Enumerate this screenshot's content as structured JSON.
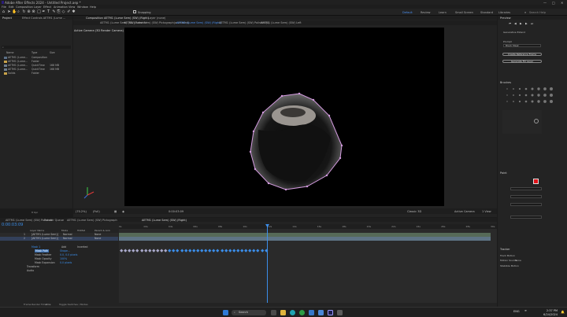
{
  "window": {
    "title": "Adobe After Effects 2024 - Untitled Project.aep *"
  },
  "menu": [
    "File",
    "Edit",
    "Composition",
    "Layer",
    "Effect",
    "Animation",
    "View",
    "Window",
    "Help"
  ],
  "toolbar": {
    "snapping_label": "Snapping",
    "default_label": "Default"
  },
  "workspaces": {
    "items": [
      "Default",
      "Review",
      "Learn",
      "Small Screen",
      "Standard",
      "Libraries"
    ],
    "active": "Default",
    "search_placeholder": "Search Help"
  },
  "project_panel": {
    "tab": "Project",
    "effect_tab": "Effect Controls AETM1 (Lume ...",
    "columns": {
      "name": "Name",
      "type": "Type",
      "size": "Size"
    },
    "items": [
      {
        "name": "AETM1 (Lume...",
        "type": "Composition",
        "size": ""
      },
      {
        "name": "AETM1 (Lume...",
        "type": "Folder",
        "size": ""
      },
      {
        "name": "AETM1 (Lume...",
        "type": "QuickTime",
        "size": "168 MB"
      },
      {
        "name": "AETM1 (Lume...",
        "type": "QuickTime",
        "size": "168 MB"
      },
      {
        "name": "Solids",
        "type": "Folder",
        "size": ""
      }
    ],
    "bpc": "8 bpc"
  },
  "composition_panel": {
    "tab_label": "Composition AETM1 (Lume Sem) (SW) (Right)",
    "layer_tab": "Layer (none)",
    "view_tabs": [
      "AETM1 (Lume Sem) (SW) Polished",
      "AETM1 (Lume Sem) (SW) Pictograph(animated)",
      "AETM1 (Lume Sem) (SW) (Right)",
      "AETM1 (Lume Sem) (SW) Polished(1)",
      "AETM1 (Lume Sem) (SW) Left"
    ],
    "camera_label": "Active Camera (3D Render Camera)",
    "zoom": "(70.2%)",
    "resolution": "(Full)",
    "timecode": "0:00:03:09",
    "renderer_label": "Classic 3D",
    "view_label": "Active Camera",
    "views_label": "1 View"
  },
  "right_panel": {
    "tabs": [
      "Info",
      "Audio",
      "Properties",
      "Libraries"
    ],
    "preview_title": "Preview",
    "generative_title": "Generative Extend",
    "prompt_label": "Prompt",
    "prompt_value": "Black Mask",
    "btn_1": "Create Reference Frame",
    "btn_2": "Generate Fill Layer",
    "brushes_title": "Brushes",
    "paint_title": "Paint",
    "tracker_title": "Tracker",
    "track_motion": "Track Motion",
    "stabilize": "Stabilize Motion",
    "motion_source": "Motion Source",
    "motion_source_value": "None"
  },
  "timeline_panel": {
    "tabs": [
      "AETM1 (Lume Sem) (SW) Polished",
      "Render Queue",
      "AETM1 (Lume Sem) (SW) Pictograph",
      "AETM1 (Lume Sem) (SW) (Right)"
    ],
    "timecode": "0:00:03:09",
    "columns": {
      "layer_name": "Layer Name",
      "mode": "Mode",
      "trkmat": "TrkMat",
      "parent": "Parent & Link"
    },
    "layers": [
      {
        "index": "1",
        "name": "[AETM1 (Lume Sem)]",
        "mode": "Normal",
        "parent": "None"
      },
      {
        "index": "2",
        "name": "[AETM1 (Lume Sem)]",
        "mode": "Normal",
        "parent": "None"
      }
    ],
    "masks": [
      {
        "name": "Mask 1",
        "mode": "Add",
        "value": "Inverted"
      },
      {
        "name": "Mask Path",
        "value": "Shape..."
      },
      {
        "name": "Mask Feather",
        "value": "0.0, 0.0 pixels"
      },
      {
        "name": "Mask Opacity",
        "value": "100%"
      },
      {
        "name": "Mask Expansion",
        "value": "0.0 pixels"
      }
    ],
    "transform_label": "Transform",
    "audio_label": "Audio",
    "frame_render": "Frame Render Time",
    "frame_render_value": "0ms",
    "toggle_label": "Toggle Switches / Modes",
    "ruler_ticks": [
      "0s",
      "02s",
      "04s",
      "06s",
      "08s",
      "10s",
      "12s",
      "14s",
      "16s",
      "18s",
      "20s",
      "22s",
      "24s",
      "26s",
      "28s",
      "30s"
    ]
  },
  "taskbar": {
    "search_placeholder": "Search",
    "time": "2:37 PM",
    "date": "6/24/2024",
    "lang": "ENG",
    "weather_temp": "",
    "icons": [
      "windows",
      "search",
      "file-explorer",
      "edge",
      "store",
      "mail",
      "chrome",
      "after-effects"
    ]
  },
  "colors": {
    "accent_blue": "#3b8eea",
    "mask_pink": "#d49be0",
    "paint_red": "#e0141a"
  }
}
